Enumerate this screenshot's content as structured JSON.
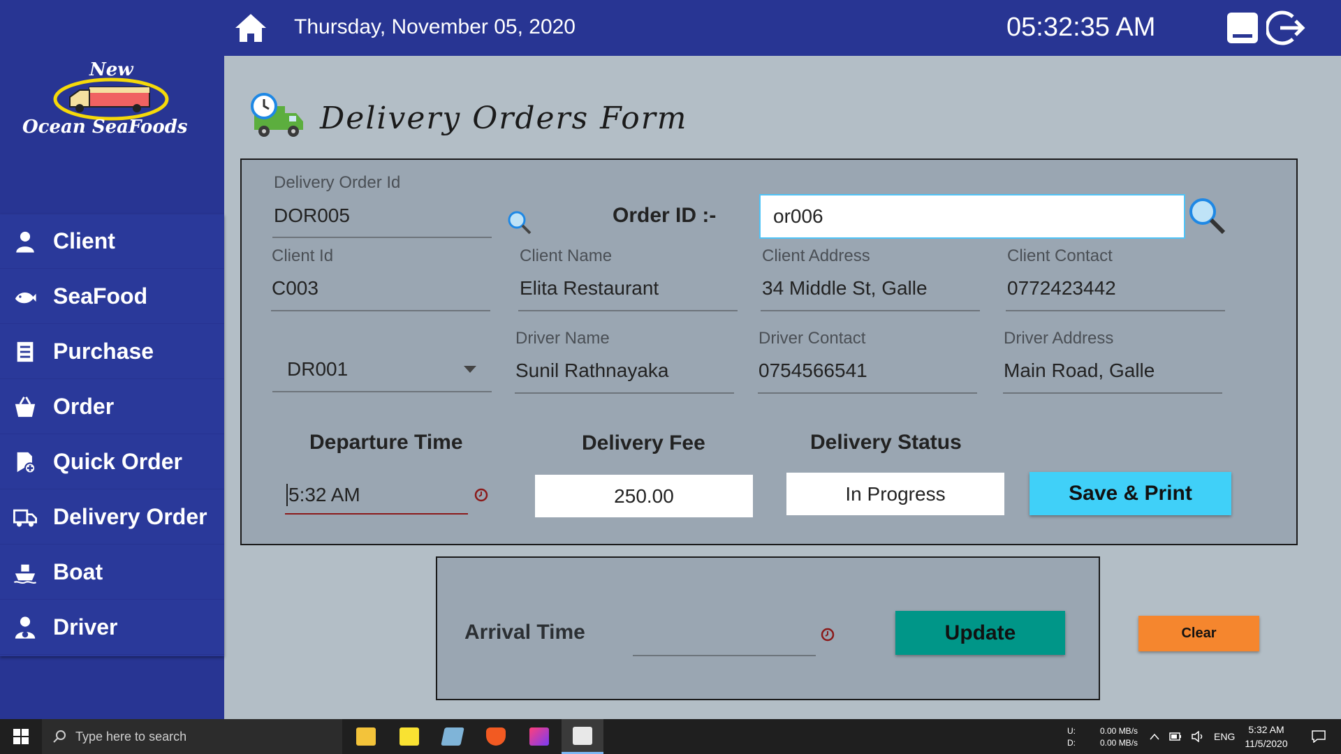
{
  "topbar": {
    "date": "Thursday, November 05, 2020",
    "time": "05:32:35 AM"
  },
  "logo": {
    "line1": "New",
    "line2": "Ocean SeaFoods"
  },
  "sidebar": {
    "items": [
      {
        "label": "Client",
        "icon": "person-icon"
      },
      {
        "label": "SeaFood",
        "icon": "fish-icon"
      },
      {
        "label": "Purchase",
        "icon": "list-icon"
      },
      {
        "label": "Order",
        "icon": "basket-icon"
      },
      {
        "label": "Quick Order",
        "icon": "quick-order-icon"
      },
      {
        "label": "Delivery Order",
        "icon": "truck-icon"
      },
      {
        "label": "Boat",
        "icon": "ship-icon"
      },
      {
        "label": "Driver",
        "icon": "driver-icon"
      }
    ]
  },
  "page": {
    "title": "Delivery Orders Form"
  },
  "form": {
    "delivery_order_id_label": "Delivery Order Id",
    "delivery_order_id": "DOR005",
    "order_id_label": "Order ID :-",
    "order_id_value": "or006",
    "client_id_label": "Client Id",
    "client_id": "C003",
    "client_name_label": "Client Name",
    "client_name": "Elita Restaurant",
    "client_address_label": "Client Address",
    "client_address": "34 Middle St, Galle",
    "client_contact_label": "Client Contact",
    "client_contact": "0772423442",
    "driver_id": "DR001",
    "driver_name_label": "Driver Name",
    "driver_name": "Sunil Rathnayaka",
    "driver_contact_label": "Driver Contact",
    "driver_contact": "0754566541",
    "driver_address_label": "Driver Address",
    "driver_address": "Main Road, Galle",
    "departure_time_label": "Departure Time",
    "departure_time": "5:32 AM",
    "delivery_fee_label": "Delivery Fee",
    "delivery_fee": "250.00",
    "delivery_status_label": "Delivery Status",
    "delivery_status": "In Progress",
    "save_print_label": "Save & Print",
    "arrival_time_label": "Arrival Time",
    "arrival_time": "",
    "update_label": "Update",
    "clear_label": "Clear"
  },
  "taskbar": {
    "search_placeholder": "Type here to search",
    "net_up_label": "U:",
    "net_down_label": "D:",
    "net_up": "0.00 MB/s",
    "net_down": "0.00 MB/s",
    "lang": "ENG",
    "time": "5:32 AM",
    "date": "11/5/2020"
  },
  "colors": {
    "sidebar": "#283593",
    "save_button": "#40d0f8",
    "update_button": "#009688",
    "clear_button": "#f5862e"
  }
}
